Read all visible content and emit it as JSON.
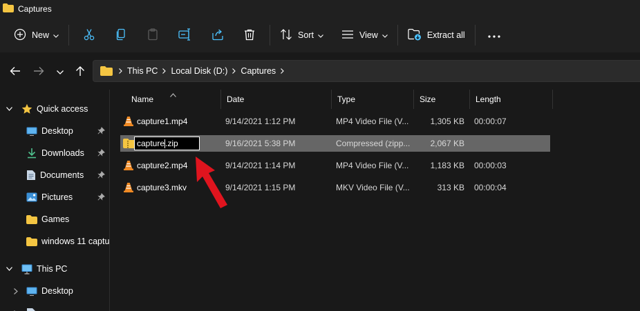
{
  "window": {
    "title": "Captures"
  },
  "toolbar": {
    "new_label": "New",
    "sort_label": "Sort",
    "view_label": "View",
    "extract_label": "Extract all"
  },
  "breadcrumb": [
    "This PC",
    "Local Disk (D:)",
    "Captures"
  ],
  "sidebar": {
    "items": [
      {
        "label": "Quick access",
        "icon": "star-icon"
      },
      {
        "label": "Desktop",
        "icon": "desktop-icon"
      },
      {
        "label": "Downloads",
        "icon": "download-icon"
      },
      {
        "label": "Documents",
        "icon": "documents-icon"
      },
      {
        "label": "Pictures",
        "icon": "pictures-icon"
      },
      {
        "label": "Games",
        "icon": "folder-icon"
      },
      {
        "label": "windows 11 captu",
        "icon": "folder-icon"
      },
      {
        "label": "This PC",
        "icon": "monitor-icon"
      },
      {
        "label": "Desktop",
        "icon": "desktop-icon"
      }
    ]
  },
  "columns": [
    "Name",
    "Date",
    "Type",
    "Size",
    "Length"
  ],
  "files": [
    {
      "name": "capture1.mp4",
      "date": "9/14/2021 1:12 PM",
      "type": "MP4 Video File (V...",
      "size": "1,305 KB",
      "length": "00:00:07",
      "icon": "vlc-icon"
    },
    {
      "name": "capture.zip",
      "name_before_cursor": "capture",
      "name_after_cursor": ".zip",
      "date": "9/16/2021 5:38 PM",
      "type": "Compressed (zipp...",
      "size": "2,067 KB",
      "length": "",
      "icon": "zip-folder-icon",
      "selected": true,
      "renaming": true
    },
    {
      "name": "capture2.mp4",
      "date": "9/14/2021 1:14 PM",
      "type": "MP4 Video File (V...",
      "size": "1,183 KB",
      "length": "00:00:03",
      "icon": "vlc-icon"
    },
    {
      "name": "capture3.mkv",
      "date": "9/14/2021 1:15 PM",
      "type": "MKV Video File (V...",
      "size": "313 KB",
      "length": "00:00:04",
      "icon": "vlc-icon"
    }
  ],
  "colors": {
    "background": "#191919",
    "chrome": "#202020",
    "selection": "#666666",
    "folder": "#f4c542",
    "annotation_arrow": "#e0141e"
  }
}
